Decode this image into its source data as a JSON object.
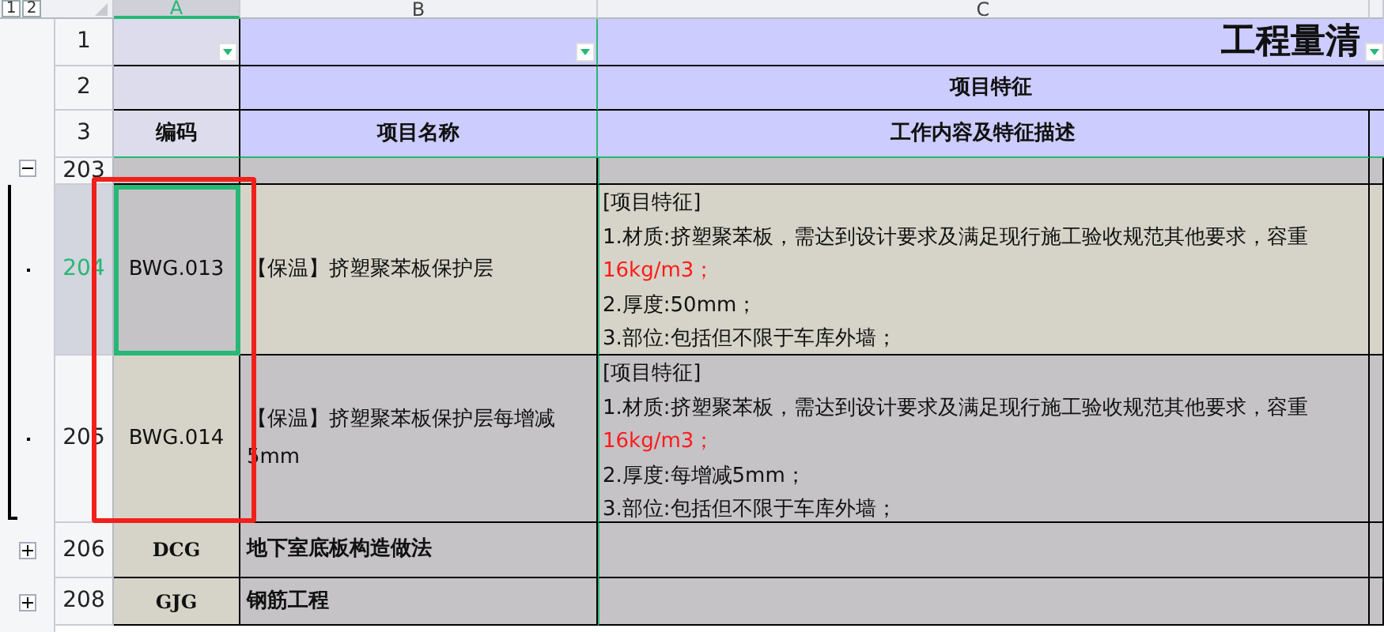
{
  "outline_levels": [
    "1",
    "2"
  ],
  "columns": [
    {
      "letter": "A",
      "selected": true
    },
    {
      "letter": "B",
      "selected": false
    },
    {
      "letter": "C",
      "selected": false
    }
  ],
  "title_row": {
    "number": "1",
    "title": "工程量清"
  },
  "group_row": {
    "number": "2",
    "label": "项目特征"
  },
  "label_row": {
    "number": "3",
    "labels": [
      "编码",
      "项目名称",
      "工作内容及特征描述"
    ]
  },
  "rows": [
    {
      "number": "203",
      "kind": "clipped",
      "expanded": true,
      "selected": false
    },
    {
      "number": "204",
      "kind": "item",
      "selected": true,
      "code": "BWG.013",
      "name": "【保温】挤塑聚苯板保护层",
      "description": [
        {
          "text": "[项目特征]",
          "highlight": false
        },
        {
          "text": "1.材质:挤塑聚苯板，需达到设计要求及满足现行施工验收规范其他要求，容重",
          "highlight": false
        },
        {
          "text": "16kg/m3；",
          "highlight": true
        },
        {
          "text": "2.厚度:50mm；",
          "highlight": false
        },
        {
          "text": "3.部位:包括但不限于车库外墙；",
          "highlight": false
        }
      ]
    },
    {
      "number": "205",
      "kind": "item",
      "selected": false,
      "code": "BWG.014",
      "name": "【保温】挤塑聚苯板保护层每增减5mm",
      "description": [
        {
          "text": "[项目特征]",
          "highlight": false
        },
        {
          "text": "1.材质:挤塑聚苯板，需达到设计要求及满足现行施工验收规范其他要求，容重",
          "highlight": false
        },
        {
          "text": "16kg/m3；",
          "highlight": true
        },
        {
          "text": "2.厚度:每增减5mm；",
          "highlight": false
        },
        {
          "text": "3.部位:包括但不限于车库外墙；",
          "highlight": false
        }
      ]
    },
    {
      "number": "206",
      "kind": "group",
      "expanded": false,
      "selected": false,
      "code": "DCG",
      "name": "地下室底板构造做法"
    },
    {
      "number": "208",
      "kind": "group",
      "expanded": false,
      "selected": false,
      "code": "GJG",
      "name": "钢筋工程"
    }
  ]
}
